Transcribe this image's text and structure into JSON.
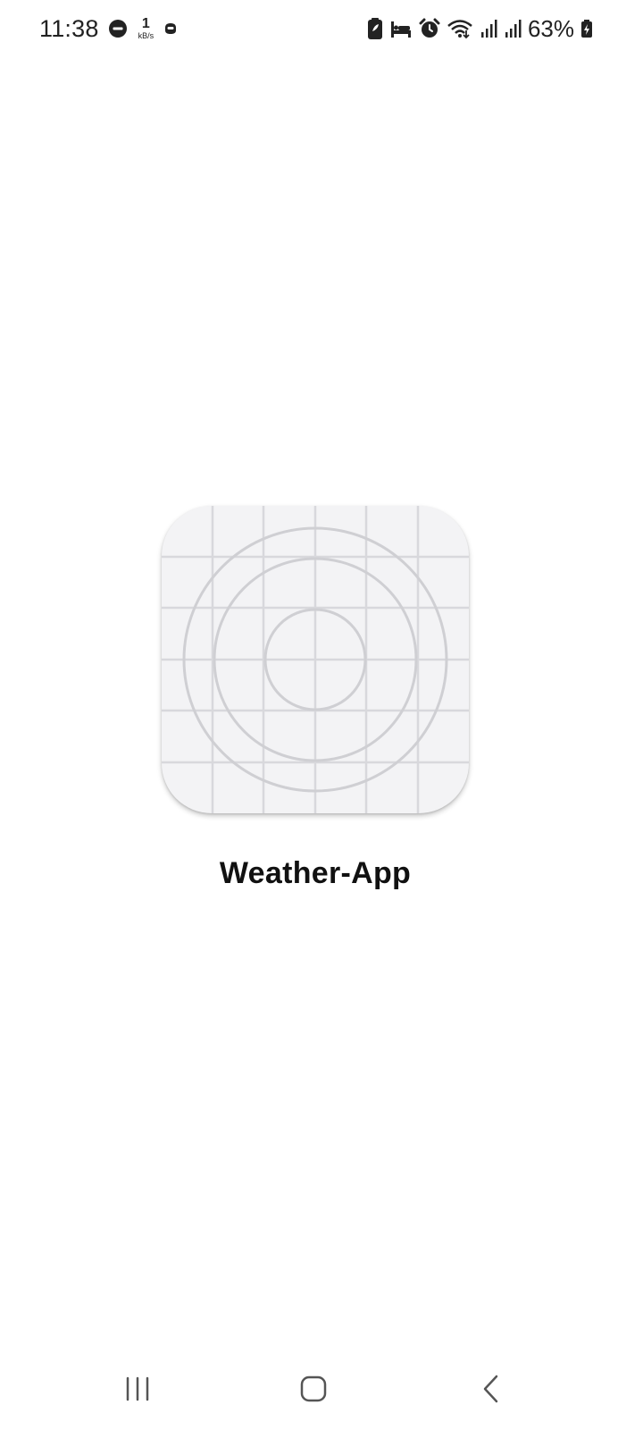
{
  "status_bar": {
    "time": "11:38",
    "net_speed_value": "1",
    "net_speed_unit": "kB/s",
    "battery_percent": "63%",
    "icons": [
      "do-not-disturb-icon",
      "network-speed-indicator",
      "app-notification-icon",
      "battery-saver-icon",
      "sleep-mode-icon",
      "alarm-icon",
      "wifi-icon",
      "signal-sim1-icon",
      "signal-sim2-icon",
      "battery-charging-icon"
    ]
  },
  "splash": {
    "app_name": "Weather-App",
    "icon": "placeholder-app-icon"
  },
  "nav_bar": {
    "buttons": [
      "recent-apps",
      "home",
      "back"
    ]
  },
  "colors": {
    "background": "#ffffff",
    "icon_background": "#f3f3f5",
    "icon_lines": "#d2d2d6",
    "text": "#111111",
    "system_icons": "#222222",
    "nav_icons": "#555555"
  }
}
